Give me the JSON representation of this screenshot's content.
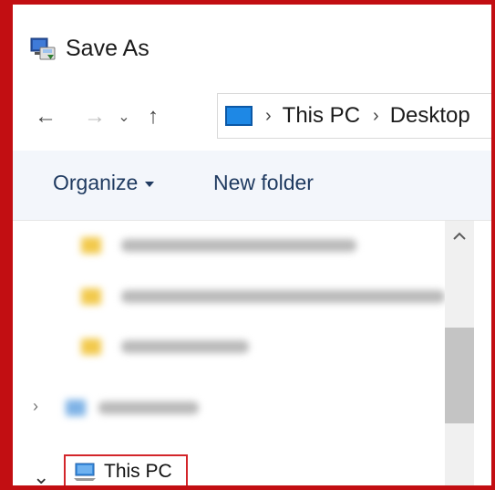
{
  "window": {
    "title": "Save As",
    "icon": "save-as-app-icon"
  },
  "navigation": {
    "back_icon": "←",
    "forward_icon": "→",
    "recent_icon": "⌄",
    "up_icon": "↑",
    "breadcrumb": [
      {
        "label": "This PC"
      },
      {
        "label": "Desktop"
      }
    ],
    "separator": "›"
  },
  "toolbar": {
    "organize_label": "Organize",
    "new_folder_label": "New folder"
  },
  "nav_pane": {
    "this_pc_label": "This PC",
    "expand_closed": "›",
    "expand_open": "⌄"
  },
  "colors": {
    "highlight_border": "#d3252a",
    "frame_border": "#c20e12",
    "toolbar_bg": "#f3f6fb",
    "toolbar_text": "#1f3a60"
  }
}
